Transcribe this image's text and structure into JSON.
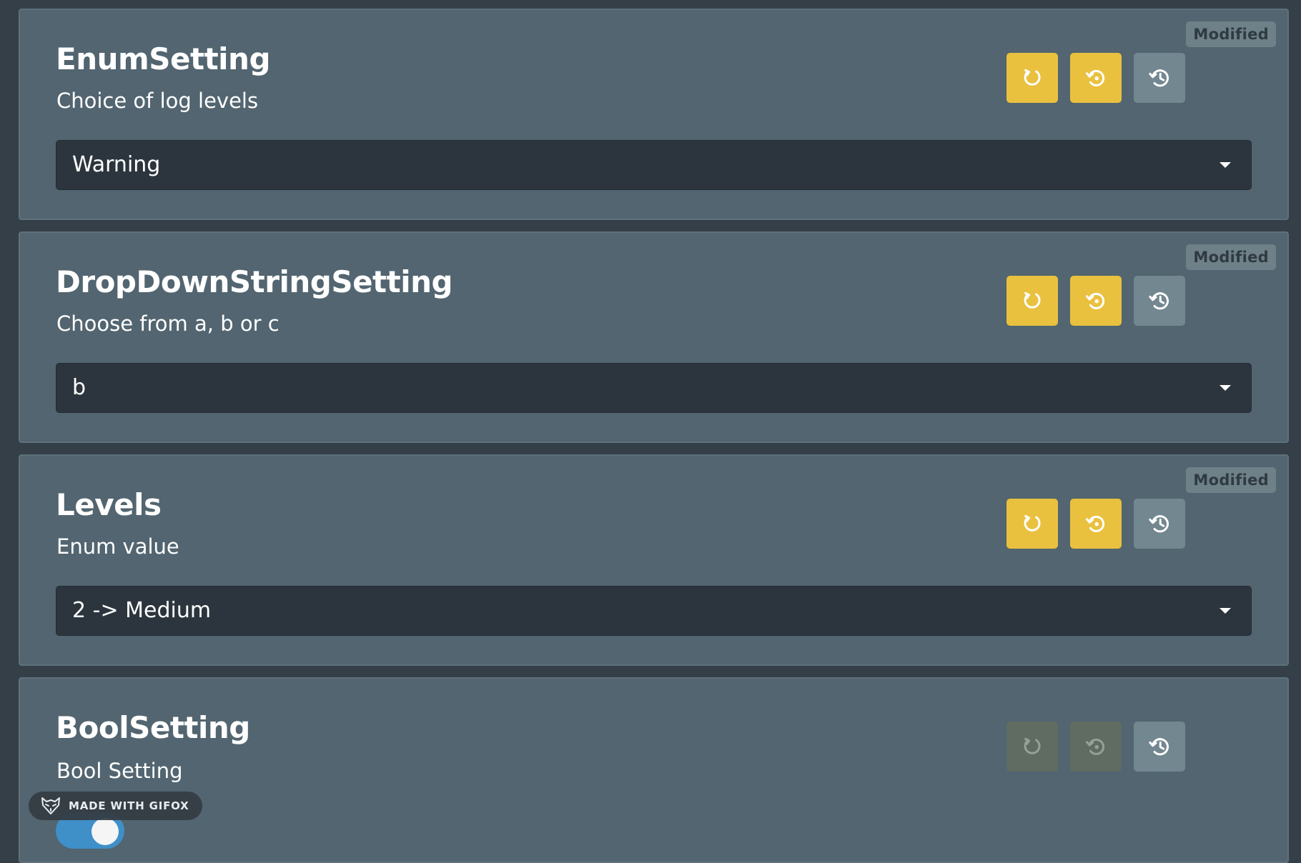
{
  "colors": {
    "page_background": "#343f47",
    "card_background": "#526570",
    "accent_yellow": "#e9c13f",
    "neutral_button": "#738790",
    "select_background": "#2c353d",
    "toggle_on": "#3f8fc8"
  },
  "settings": [
    {
      "title": "EnumSetting",
      "description": "Choice of log levels",
      "badge": "Modified",
      "value": "Warning",
      "control": "dropdown",
      "actions": [
        {
          "icon": "rotate-icon",
          "enabled": true
        },
        {
          "icon": "restore-default-icon",
          "enabled": true
        },
        {
          "icon": "history-icon",
          "enabled": true
        }
      ]
    },
    {
      "title": "DropDownStringSetting",
      "description": "Choose from a, b or c",
      "badge": "Modified",
      "value": "b",
      "control": "dropdown",
      "actions": [
        {
          "icon": "rotate-icon",
          "enabled": true
        },
        {
          "icon": "restore-default-icon",
          "enabled": true
        },
        {
          "icon": "history-icon",
          "enabled": true
        }
      ]
    },
    {
      "title": "Levels",
      "description": "Enum value",
      "badge": "Modified",
      "value": "2 -> Medium",
      "control": "dropdown",
      "actions": [
        {
          "icon": "rotate-icon",
          "enabled": true
        },
        {
          "icon": "restore-default-icon",
          "enabled": true
        },
        {
          "icon": "history-icon",
          "enabled": true
        }
      ]
    },
    {
      "title": "BoolSetting",
      "description": "Bool Setting",
      "control": "toggle",
      "checked": true,
      "actions": [
        {
          "icon": "rotate-icon",
          "enabled": false
        },
        {
          "icon": "restore-default-icon",
          "enabled": false
        },
        {
          "icon": "history-icon",
          "enabled": true
        }
      ]
    }
  ],
  "watermark": {
    "icon": "fox-logo-icon",
    "label": "MADE WITH GIFOX"
  }
}
